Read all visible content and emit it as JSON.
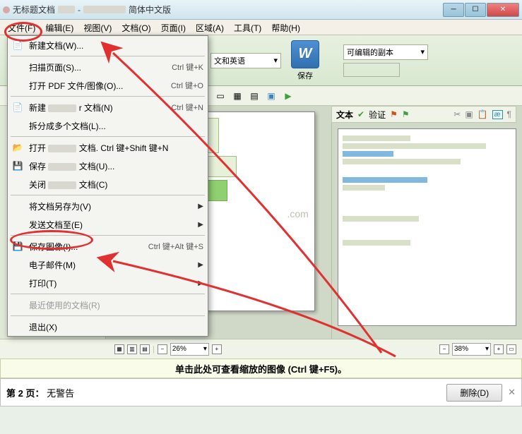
{
  "titlebar": {
    "title": "无标题文档",
    "subtitle": "简体中文版"
  },
  "menubar": [
    "文件(F)",
    "编辑(E)",
    "视图(V)",
    "文档(O)",
    "页面(I)",
    "区域(A)",
    "工具(T)",
    "帮助(H)"
  ],
  "toolbar": {
    "lang": "文和英语",
    "save_btn": "保存",
    "editable": "可编辑的副本"
  },
  "dropdown": {
    "items": [
      {
        "label": "新建文档(W)...",
        "icon": "📄",
        "shortcut": "",
        "arrow": false,
        "circled": true
      },
      {
        "sep": true
      },
      {
        "label": "扫描页面(S)...",
        "icon": "",
        "shortcut": "Ctrl 键+K",
        "arrow": false
      },
      {
        "label": "打开 PDF 文件/图像(O)...",
        "icon": "",
        "shortcut": "Ctrl 键+O",
        "arrow": false
      },
      {
        "sep": true
      },
      {
        "label": "新建",
        "icon": "📄",
        "blur": "r 文档(N)",
        "shortcut": "Ctrl 键+N",
        "arrow": false
      },
      {
        "label": "拆分成多个文档(L)...",
        "icon": "",
        "shortcut": "",
        "arrow": false
      },
      {
        "sep": true
      },
      {
        "label": "打开",
        "icon": "📂",
        "blur": "文档. Ctrl 键+Shift 键+N",
        "shortcut": "",
        "arrow": false
      },
      {
        "label": "保存",
        "icon": "💾",
        "blur": "文档(U)...",
        "shortcut": "",
        "arrow": false
      },
      {
        "label": "关闭",
        "icon": "",
        "blur": "文档(C)",
        "shortcut": "",
        "arrow": false
      },
      {
        "sep": true
      },
      {
        "label": "将文档另存为(V)",
        "icon": "",
        "shortcut": "",
        "arrow": true
      },
      {
        "label": "发送文档至(E)",
        "icon": "",
        "shortcut": "",
        "arrow": true
      },
      {
        "sep": true
      },
      {
        "label": "保存图像(I)...",
        "icon": "💾",
        "shortcut": "Ctrl 键+Alt 键+S",
        "arrow": false,
        "circled": true
      },
      {
        "label": "电子邮件(M)",
        "icon": "",
        "shortcut": "",
        "arrow": true
      },
      {
        "label": "打印(T)",
        "icon": "",
        "shortcut": "",
        "arrow": true
      },
      {
        "sep": true
      },
      {
        "label": "最近使用的文档(R)",
        "icon": "",
        "shortcut": "",
        "arrow": false,
        "disabled": true
      },
      {
        "sep": true
      },
      {
        "label": "退出(X)",
        "icon": "",
        "shortcut": "",
        "arrow": false
      }
    ]
  },
  "text_panel": {
    "header": "文本",
    "verify": "验证"
  },
  "status": {
    "zoom1": "26%",
    "zoom2": "38%"
  },
  "hint": "单击此处可查看缩放的图像 (Ctrl 键+F5)。",
  "page_info": {
    "page": "第 2 页：",
    "warning": "无警告",
    "delete": "删除(D)"
  }
}
